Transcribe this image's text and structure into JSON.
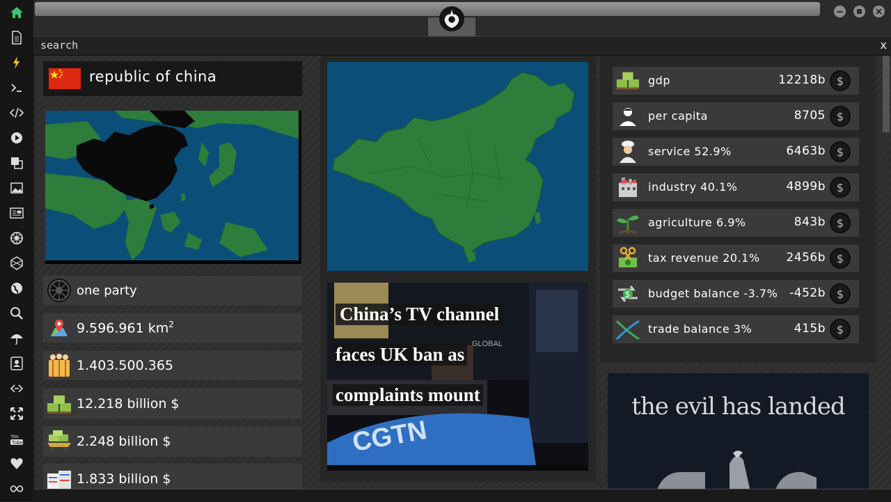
{
  "window": {
    "search_label": "search",
    "close_label": "x"
  },
  "country": {
    "name": "republic of china",
    "government": "one party",
    "area_value": "9.596.961 km",
    "area_unit_sup": "2",
    "population": "1.403.500.365",
    "gdp_total": "12.218 billion $",
    "stat_2": "2.248 billion $",
    "stat_3": "1.833 billion $"
  },
  "economy": [
    {
      "label": "gdp",
      "value": "12218b",
      "icon": "money-stack-icon"
    },
    {
      "label": "per capita",
      "value": "8705",
      "icon": "person-icon"
    },
    {
      "label": "service 52.9%",
      "value": "6463b",
      "icon": "chef-icon"
    },
    {
      "label": "industry 40.1%",
      "value": "4899b",
      "icon": "factory-icon"
    },
    {
      "label": "agriculture 6.9%",
      "value": "843b",
      "icon": "plant-icon"
    },
    {
      "label": "tax revenue 20.1%",
      "value": "2456b",
      "icon": "cut-money-icon"
    },
    {
      "label": "budget balance -3.7%",
      "value": "-452b",
      "icon": "exchange-icon"
    },
    {
      "label": "trade balance 3%",
      "value": "415b",
      "icon": "trade-icon"
    }
  ],
  "coin_symbol": "$",
  "news": {
    "line1": "China’s TV channel",
    "line2": "faces UK ban as",
    "line3": "complaints mount",
    "brand": "CGTN",
    "tag": "GLOBAL"
  },
  "ad": {
    "title": "the evil has landed"
  },
  "colors": {
    "sea": "#0b4f78",
    "land": "#2e7d3a",
    "china": "#0a0a0a",
    "flag_red": "#de2910",
    "flag_star": "#ffde00"
  }
}
